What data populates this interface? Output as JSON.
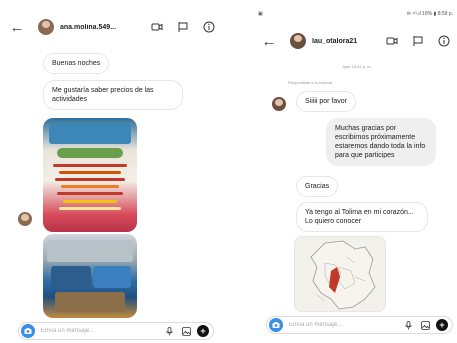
{
  "left": {
    "header": {
      "username": "ana.molina.549..."
    },
    "messages": [
      {
        "id": "m1",
        "text": "Buenas noches"
      },
      {
        "id": "m2",
        "text": "Me gustaría saber precios de las actividades"
      }
    ],
    "composer": {
      "placeholder": "Envía un mensaje..."
    }
  },
  "right": {
    "status": {
      "left": "▣",
      "right": "✉ ⁴ᴳ.ıl 18% ▮ 8:59 p."
    },
    "header": {
      "username": "lau_otalora21"
    },
    "timestamp": "Ayer 10:43 p. m.",
    "reply_note": "Respondiste a tu historia",
    "messages": [
      {
        "id": "r1",
        "text": "Siiiii por favor"
      },
      {
        "id": "r2",
        "text": "Muchas gracias por escribirnos próximamente estaremos dando toda la info para que participes"
      },
      {
        "id": "r3",
        "text": "Gracias"
      },
      {
        "id": "r4",
        "text": "Ya tengo al Tolima en mi corazón... Lo quiero conocer"
      }
    ],
    "composer": {
      "placeholder": "Envía un mensaje..."
    }
  },
  "icons": [
    "back-arrow-icon",
    "video-call-icon",
    "flag-icon",
    "info-icon",
    "camera-icon",
    "microphone-icon",
    "gallery-icon",
    "plus-icon"
  ],
  "colors": {
    "camera_blue": "#3a8ee6",
    "outgoing_bubble": "#efefef",
    "map_highlight": "#c0392b"
  }
}
